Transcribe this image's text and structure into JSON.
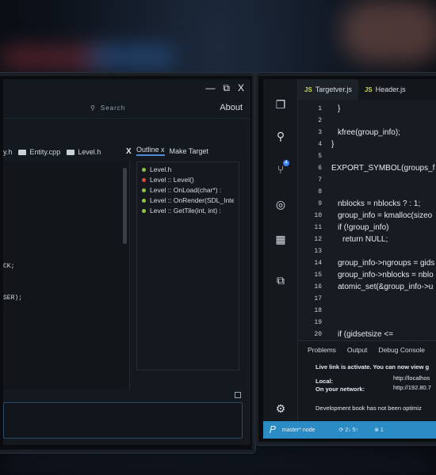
{
  "left_window": {
    "controls": {
      "close": "X"
    },
    "search_label": "Search",
    "about_label": "About",
    "tabs": [
      {
        "label": "y.h"
      },
      {
        "label": "Entity.cpp"
      },
      {
        "label": "Level.h"
      }
    ],
    "tab_close": "X",
    "code_lines": [
      "CK;",
      "SER);"
    ],
    "outline": {
      "tab_outline": "Outline x",
      "tab_make_target": "Make Target",
      "items": [
        {
          "label": "Level.h",
          "color": "#8dc63f"
        },
        {
          "label": "Level :: Level()",
          "color": "#e04c3c"
        },
        {
          "label": "Level :: OnLoad(char*)   :",
          "color": "#8dc63f"
        },
        {
          "label": "Level :: OnRender(SDL_Inte",
          "color": "#8dc63f"
        },
        {
          "label": "Level :: GetTile(int, int)   :",
          "color": "#8dc63f"
        }
      ]
    }
  },
  "right_window": {
    "tabs": [
      {
        "prefix": "JS",
        "label": "Targetver.js"
      },
      {
        "prefix": "JS",
        "label": "Header.js"
      }
    ],
    "badge": "4",
    "code": [
      {
        "n": "1",
        "t": "}"
      },
      {
        "n": "2",
        "t": ""
      },
      {
        "n": "3",
        "t": "kfree(group_info);"
      },
      {
        "n": "4",
        "t": "}"
      },
      {
        "n": "5",
        "t": ""
      },
      {
        "n": "6",
        "t": "EXPORT_SYMBOL(groups_f"
      },
      {
        "n": "7",
        "t": ""
      },
      {
        "n": "8",
        "t": ""
      },
      {
        "n": "9",
        "t": "nblocks = nblocks ? : 1;"
      },
      {
        "n": "10",
        "t": "group_info = kmalloc(sizeo"
      },
      {
        "n": "11",
        "t": "if (!group_info)"
      },
      {
        "n": "12",
        "t": "return NULL;"
      },
      {
        "n": "13",
        "t": ""
      },
      {
        "n": "14",
        "t": "group_info->ngroups = gids"
      },
      {
        "n": "15",
        "t": "group_info->nblocks = nblo"
      },
      {
        "n": "16",
        "t": "atomic_set(&group_info->u"
      },
      {
        "n": "17",
        "t": ""
      },
      {
        "n": "18",
        "t": ""
      },
      {
        "n": "19",
        "t": ""
      },
      {
        "n": "20",
        "t": "if (gidsetsize <="
      }
    ],
    "panel": {
      "tabs": [
        "Problems",
        "Output",
        "Debug Console"
      ],
      "live_link": "Live link is activate. You can now view g",
      "local_label": "Local:",
      "local_url": "http://localhos",
      "network_label": "On your network:",
      "network_url": "http://192.80.7",
      "dev_note": "Development book has not been optimiz"
    },
    "statusbar": {
      "branch": "master* node",
      "sync": "⟳ 2↓ 5↑",
      "errors": "⊗ 1"
    },
    "colors": {
      "accent": "#2b8bc4"
    }
  }
}
